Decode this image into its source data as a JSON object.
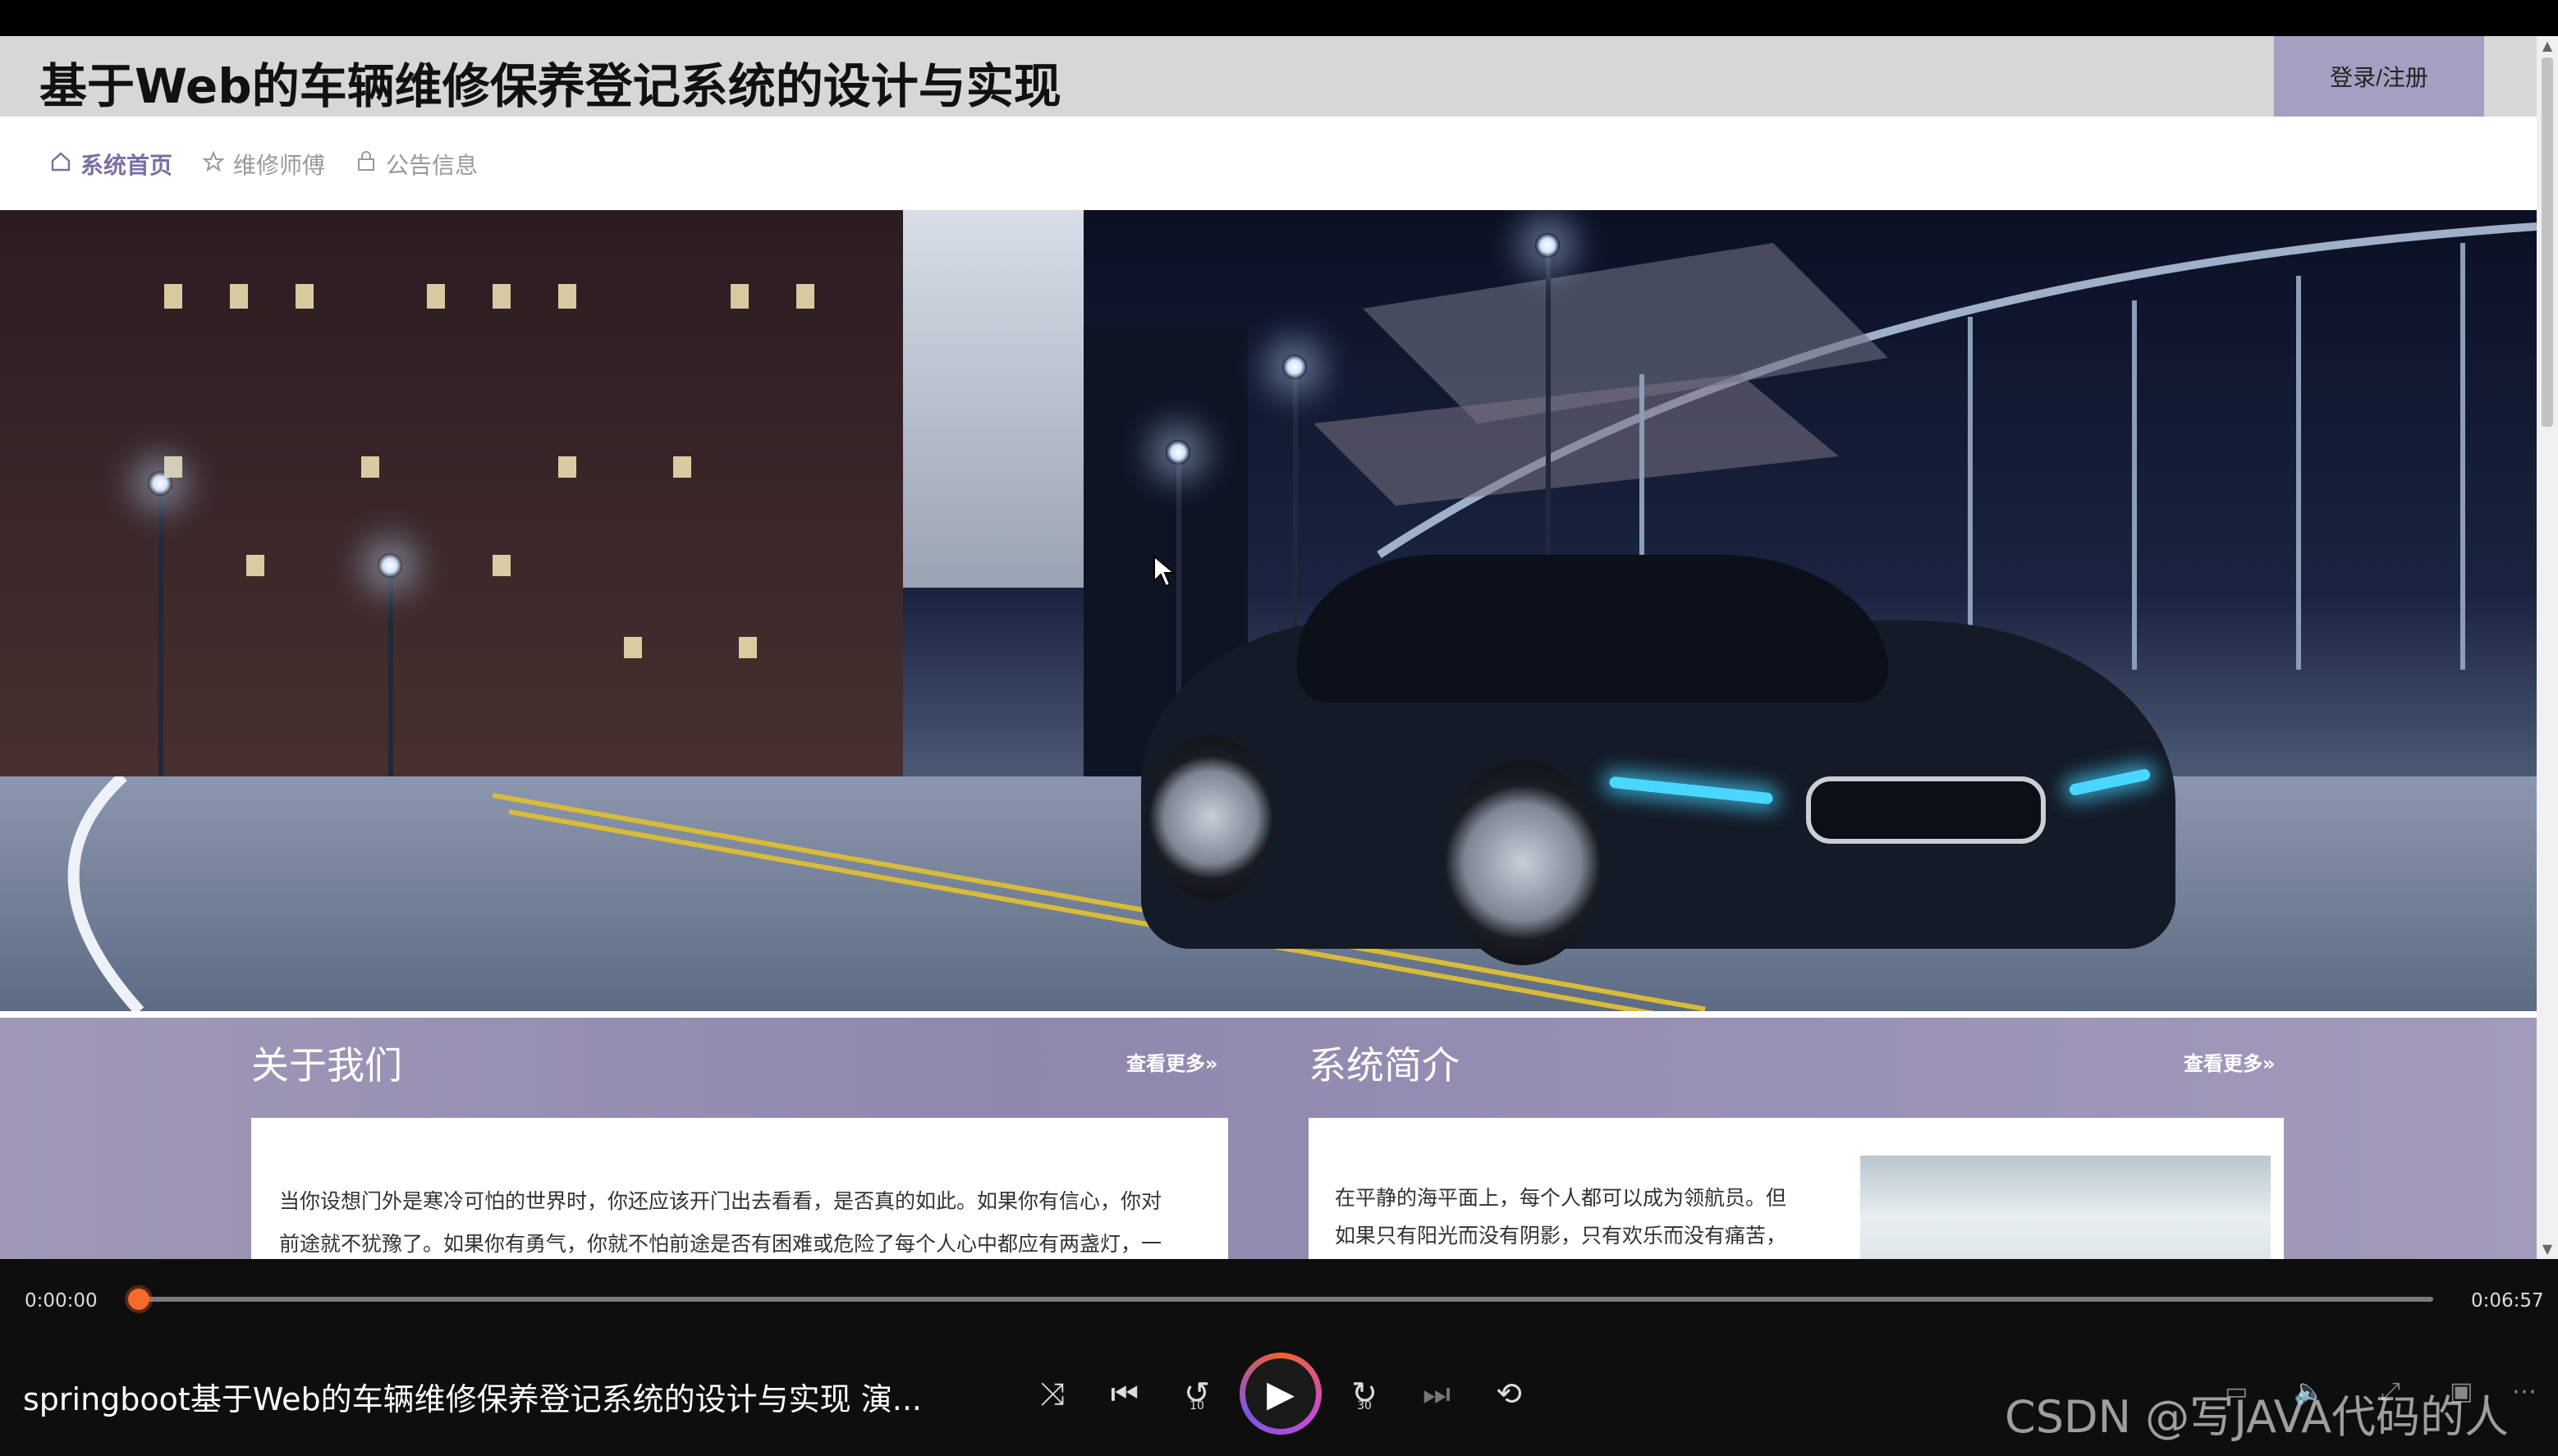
{
  "site": {
    "title": "基于Web的车辆维修保养登记系统的设计与实现",
    "login_label": "登录/注册",
    "nav": [
      {
        "label": "系统首页",
        "icon": "home-icon",
        "active": true
      },
      {
        "label": "维修师傅",
        "icon": "star-icon",
        "active": false
      },
      {
        "label": "公告信息",
        "icon": "bag-icon",
        "active": false
      }
    ],
    "accent_color": "#a79fc1",
    "about": {
      "title": "关于我们",
      "more": "查看更多»",
      "lines": [
        "当你设想门外是寒冷可怕的世界时，你还应该开门出去看看，是否真的如此。如果你有信心，你对",
        "前途就不犹豫了。如果你有勇气，你就不怕前途是否有困难或危险了每个人心中都应有两盏灯，一"
      ]
    },
    "intro": {
      "title": "系统简介",
      "more": "查看更多»",
      "lines": [
        "在平静的海平面上，每个人都可以成为领航员。但",
        "如果只有阳光而没有阴影，只有欢乐而没有痛苦，"
      ]
    }
  },
  "player": {
    "current_time": "0:00:00",
    "total_time": "0:06:57",
    "progress": 0.0,
    "title": "springboot基于Web的车辆维修保养登记系统的设计与实现 演...",
    "controls": [
      {
        "name": "shuffle-button",
        "glyph": "⤨"
      },
      {
        "name": "previous-button",
        "glyph": "⏮"
      },
      {
        "name": "rewind-10-button",
        "glyph": "↺"
      },
      {
        "name": "forward-30-button",
        "glyph": "↻"
      },
      {
        "name": "next-button",
        "glyph": "⏭"
      },
      {
        "name": "repeat-off-button",
        "glyph": "⟲"
      }
    ],
    "play_glyph": "▶",
    "rewind_label": "10",
    "forward_label": "30"
  },
  "watermark": "CSDN @写JAVA代码的人"
}
